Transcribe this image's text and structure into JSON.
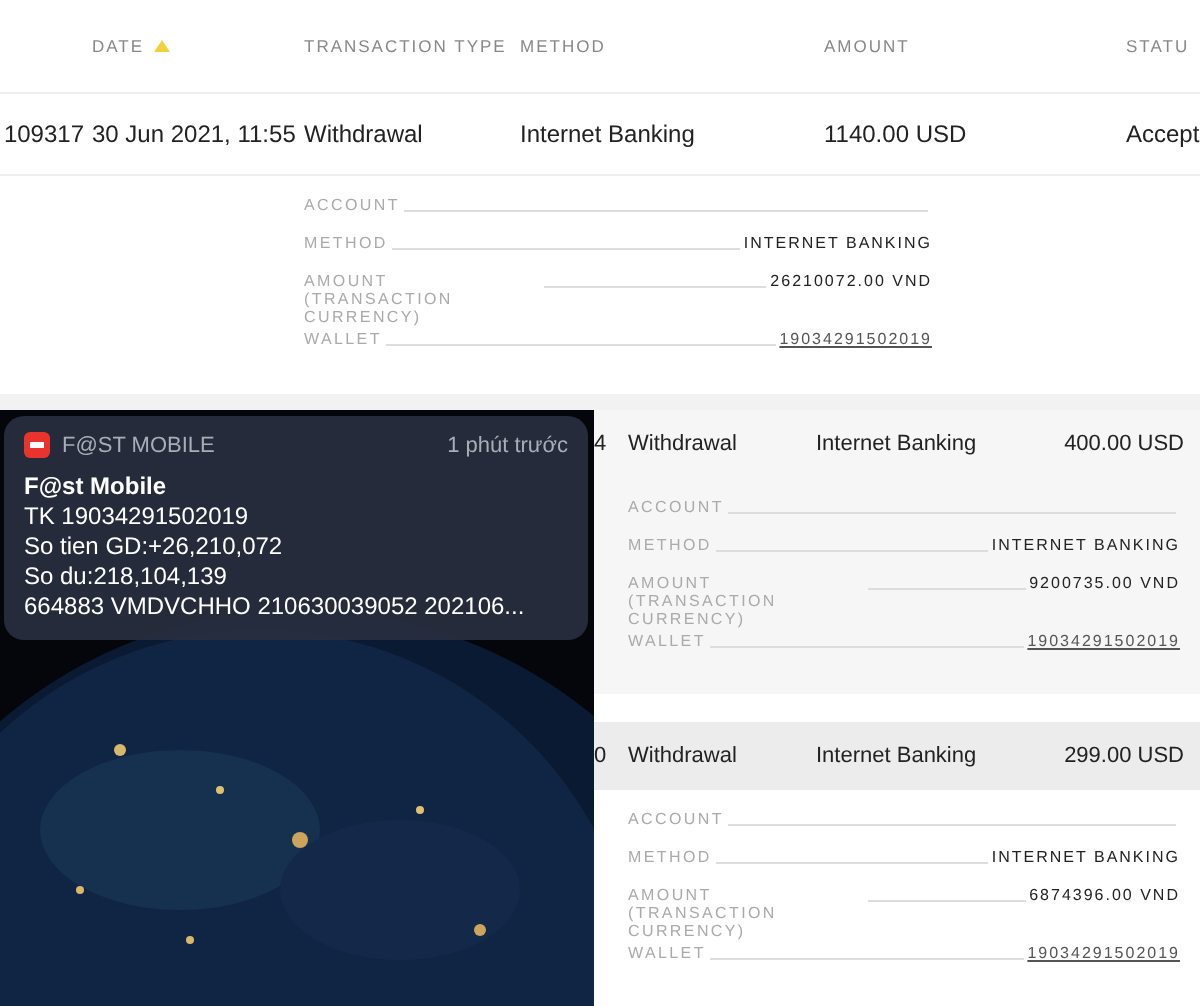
{
  "main_panel": {
    "columns": [
      {
        "label": "DATE",
        "sorted": true
      },
      {
        "label": "TRANSACTION TYPE",
        "sorted": false
      },
      {
        "label": "METHOD",
        "sorted": false
      },
      {
        "label": "AMOUNT",
        "sorted": false
      },
      {
        "label": "STATU",
        "sorted": false
      }
    ],
    "row": {
      "cells": [
        "109317",
        "30 Jun 2021, 11:55",
        "Withdrawal",
        "Internet Banking",
        "1140.00 USD",
        "Accept"
      ]
    },
    "details": [
      {
        "label": "ACCOUNT"
      },
      {
        "label": "METHOD",
        "value": "INTERNET BANKING",
        "kind": "text"
      },
      {
        "label": "AMOUNT (TRANSACTION CURRENCY)",
        "value": "26210072.00 VND",
        "kind": "text"
      },
      {
        "label": "WALLET",
        "value": "19034291502019",
        "kind": "link"
      }
    ]
  },
  "notification": {
    "app": "F@ST MOBILE",
    "time": "1 phút trước",
    "title": "F@st Mobile",
    "lines": [
      "TK 19034291502019",
      "So tien GD:+26,210,072",
      "So du:218,104,139",
      "664883 VMDVCHHO 210630039052 202106..."
    ]
  },
  "side_panels": [
    {
      "row": {
        "cells": [
          "4",
          "Withdrawal",
          "Internet Banking",
          "400.00 USD"
        ]
      },
      "details": [
        {
          "label": "ACCOUNT"
        },
        {
          "label": "METHOD",
          "value": "INTERNET BANKING",
          "kind": "text"
        },
        {
          "label": "AMOUNT (TRANSACTION CURRENCY)",
          "value": "9200735.00 VND",
          "kind": "text"
        },
        {
          "label": "WALLET",
          "value": "19034291502019",
          "kind": "link"
        }
      ]
    },
    {
      "row": {
        "cells": [
          "0",
          "Withdrawal",
          "Internet Banking",
          "299.00 USD"
        ],
        "highlighted": true
      },
      "details": [
        {
          "label": "ACCOUNT"
        },
        {
          "label": "METHOD",
          "value": "INTERNET BANKING",
          "kind": "text"
        },
        {
          "label": "AMOUNT (TRANSACTION CURRENCY)",
          "value": "6874396.00 VND",
          "kind": "text"
        },
        {
          "label": "WALLET",
          "value": "19034291502019",
          "kind": "link"
        }
      ]
    }
  ]
}
